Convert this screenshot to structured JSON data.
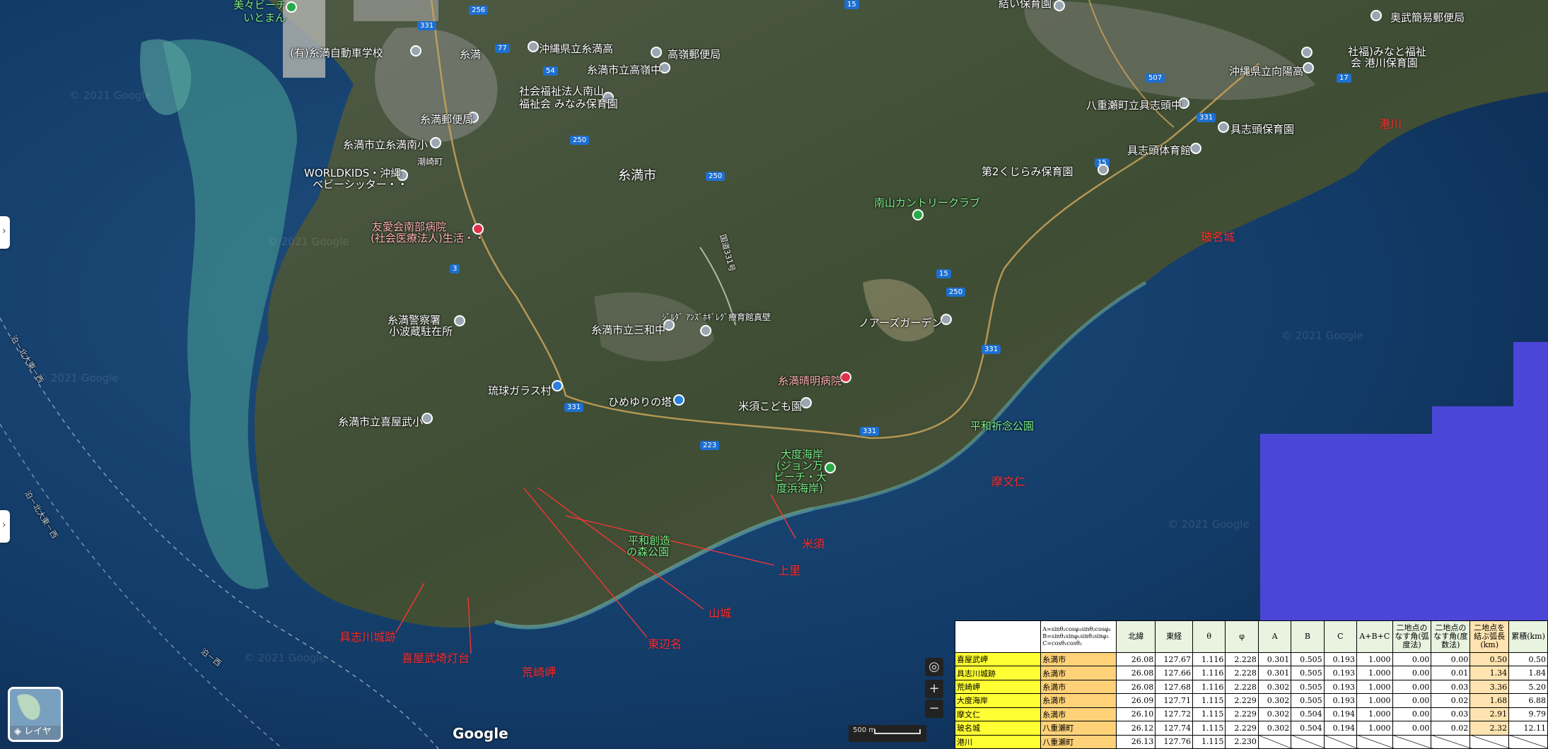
{
  "map_labels": [
    {
      "text": "美々ビーチ",
      "kind": "green"
    },
    {
      "text": "いとまん",
      "kind": "green"
    },
    {
      "text": "(有)糸満自動車学校",
      "kind": "white"
    },
    {
      "text": "糸満",
      "kind": "white"
    },
    {
      "text": "沖縄県立糸満高",
      "kind": "white"
    },
    {
      "text": "高嶺郵便局",
      "kind": "white"
    },
    {
      "text": "糸満市立高嶺中",
      "kind": "white"
    },
    {
      "text": "社会福祉法人南山",
      "kind": "white"
    },
    {
      "text": "福祉会 みなみ保育園",
      "kind": "white"
    },
    {
      "text": "糸満郵便局",
      "kind": "white"
    },
    {
      "text": "糸満市立糸満南小",
      "kind": "white"
    },
    {
      "text": "潮崎町",
      "kind": "white"
    },
    {
      "text": "WORLDKIDS・沖縄",
      "kind": "white"
    },
    {
      "text": "ベビーシッター・・",
      "kind": "white"
    },
    {
      "text": "糸満市",
      "kind": "city"
    },
    {
      "text": "友愛会南部病院",
      "kind": "white"
    },
    {
      "text": "(社会医療法人)生活・・",
      "kind": "white"
    },
    {
      "text": "糸満警察署",
      "kind": "white"
    },
    {
      "text": "小波蔵駐在所",
      "kind": "white"
    },
    {
      "text": "糸満市立三和中",
      "kind": "white"
    },
    {
      "text": "ｼﾞﾙﾀﾞ ｱﾝｽﾞﾎｷﾞﾚｸﾞ療育館真壁",
      "kind": "white"
    },
    {
      "text": "琉球ガラス村",
      "kind": "white"
    },
    {
      "text": "ひめゆりの塔",
      "kind": "white"
    },
    {
      "text": "米須こども園",
      "kind": "white"
    },
    {
      "text": "糸満晴明病院",
      "kind": "white"
    },
    {
      "text": "糸満市立喜屋武小",
      "kind": "white"
    },
    {
      "text": "大度海岸",
      "kind": "green"
    },
    {
      "text": "(ジョン万",
      "kind": "green"
    },
    {
      "text": "ビーチ・大",
      "kind": "green"
    },
    {
      "text": "度浜海岸)",
      "kind": "green"
    },
    {
      "text": "平和創造",
      "kind": "green"
    },
    {
      "text": "の森公園",
      "kind": "green"
    },
    {
      "text": "ノアーズガーデン",
      "kind": "white"
    },
    {
      "text": "平和祈念公園",
      "kind": "green"
    },
    {
      "text": "南山カントリークラブ",
      "kind": "green"
    },
    {
      "text": "第2くじらみ保育園",
      "kind": "white"
    },
    {
      "text": "具志頭体育館",
      "kind": "white"
    },
    {
      "text": "八重瀬町立具志頭中",
      "kind": "white"
    },
    {
      "text": "具志頭保育園",
      "kind": "white"
    },
    {
      "text": "沖縄県立向陽高",
      "kind": "white"
    },
    {
      "text": "社福)みなと福祉",
      "kind": "white"
    },
    {
      "text": "会 港川保育園",
      "kind": "white"
    },
    {
      "text": "奥武簡易郵便局",
      "kind": "white"
    },
    {
      "text": "結い保育園",
      "kind": "white"
    },
    {
      "text": "国道331号",
      "kind": "white"
    }
  ],
  "red_labels": [
    "港川",
    "玻名城",
    "摩文仁",
    "米須",
    "上里",
    "山城",
    "東辺名",
    "具志川城跡",
    "喜屋武埼灯台",
    "荒崎岬"
  ],
  "route_shields": [
    "331",
    "256",
    "77",
    "54",
    "250",
    "250",
    "3",
    "331",
    "223",
    "331",
    "331",
    "250",
    "15",
    "507",
    "17",
    "331",
    "15",
    "15"
  ],
  "sea_labels": [
    "泊－北大東－西",
    "泊－北大東－西",
    "泊－西"
  ],
  "watermark": "© 2021 Google",
  "controls": {
    "layers_label": "レイヤ",
    "zoom_in": "+",
    "zoom_out": "−",
    "locate_icon": "◎",
    "google_logo": "Google",
    "scale": "500 m"
  },
  "table": {
    "formula_lines": [
      "A=sinθ₁cosφ₁sinθ₂cosφ₂",
      "B=sinθ₁sinφ₁sinθ₂sinφ₂",
      "C=cosθ₁cosθ₂"
    ],
    "headers": [
      "北緯",
      "東経",
      "θ",
      "φ",
      "A",
      "B",
      "C",
      "A+B+C",
      "二地点のなす角(弧度法)",
      "二地点のなす角(度数法)",
      "二地点を結ぶ弧長(km)",
      "累積(km)"
    ],
    "rows": [
      {
        "name": "喜屋武岬",
        "city": "糸満市",
        "lat": "26.08",
        "lon": "127.67",
        "theta": "1.116",
        "phi": "2.228",
        "A": "0.301",
        "B": "0.505",
        "C": "0.193",
        "sum": "1.000",
        "rad": "0.00",
        "deg": "0.00",
        "arc": "0.50",
        "cum": "0.50"
      },
      {
        "name": "具志川城跡",
        "city": "糸満市",
        "lat": "26.08",
        "lon": "127.66",
        "theta": "1.116",
        "phi": "2.228",
        "A": "0.301",
        "B": "0.505",
        "C": "0.193",
        "sum": "1.000",
        "rad": "0.00",
        "deg": "0.01",
        "arc": "1.34",
        "cum": "1.84"
      },
      {
        "name": "荒崎岬",
        "city": "糸満市",
        "lat": "26.08",
        "lon": "127.68",
        "theta": "1.116",
        "phi": "2.228",
        "A": "0.302",
        "B": "0.505",
        "C": "0.193",
        "sum": "1.000",
        "rad": "0.00",
        "deg": "0.03",
        "arc": "3.36",
        "cum": "5.20"
      },
      {
        "name": "大度海岸",
        "city": "糸満市",
        "lat": "26.09",
        "lon": "127.71",
        "theta": "1.115",
        "phi": "2.229",
        "A": "0.302",
        "B": "0.505",
        "C": "0.193",
        "sum": "1.000",
        "rad": "0.00",
        "deg": "0.02",
        "arc": "1.68",
        "cum": "6.88"
      },
      {
        "name": "摩文仁",
        "city": "糸満市",
        "lat": "26.10",
        "lon": "127.72",
        "theta": "1.115",
        "phi": "2.229",
        "A": "0.302",
        "B": "0.504",
        "C": "0.194",
        "sum": "1.000",
        "rad": "0.00",
        "deg": "0.03",
        "arc": "2.91",
        "cum": "9.79"
      },
      {
        "name": "玻名城",
        "city": "八重瀬町",
        "lat": "26.12",
        "lon": "127.74",
        "theta": "1.115",
        "phi": "2.229",
        "A": "0.302",
        "B": "0.504",
        "C": "0.194",
        "sum": "1.000",
        "rad": "0.00",
        "deg": "0.02",
        "arc": "2.32",
        "cum": "12.11"
      },
      {
        "name": "港川",
        "city": "八重瀬町",
        "lat": "26.13",
        "lon": "127.76",
        "theta": "1.115",
        "phi": "2.230",
        "A": "",
        "B": "",
        "C": "",
        "sum": "",
        "rad": "",
        "deg": "",
        "arc": "",
        "cum": ""
      }
    ]
  }
}
